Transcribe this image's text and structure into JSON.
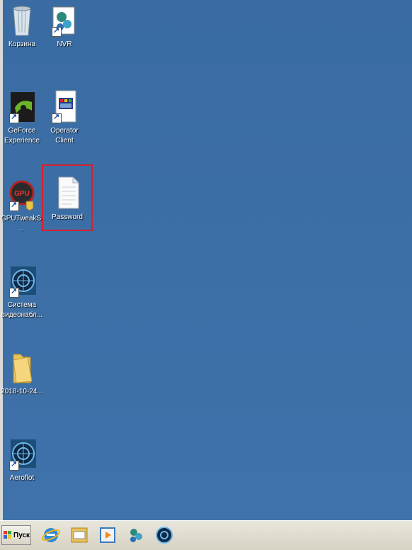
{
  "desktop": {
    "icons": [
      {
        "name": "recycle-bin",
        "label": "Корзина"
      },
      {
        "name": "nvr",
        "label": "NVR"
      },
      {
        "name": "geforce-experience",
        "label": "GeForce Experience"
      },
      {
        "name": "operator-client",
        "label": "Operator Client"
      },
      {
        "name": "gputweak",
        "label": "GPUTweakS..."
      },
      {
        "name": "password-file",
        "label": "Password"
      },
      {
        "name": "sistema-videonabl",
        "label": "Система видеонабл..."
      },
      {
        "name": "folder-2018",
        "label": "2018-10-24..."
      },
      {
        "name": "aeroflot",
        "label": "Aeroflot"
      }
    ]
  },
  "taskbar": {
    "start_label": "Пуск"
  },
  "colors": {
    "desktop": "#3d6fa6",
    "highlight": "#d6212b"
  }
}
